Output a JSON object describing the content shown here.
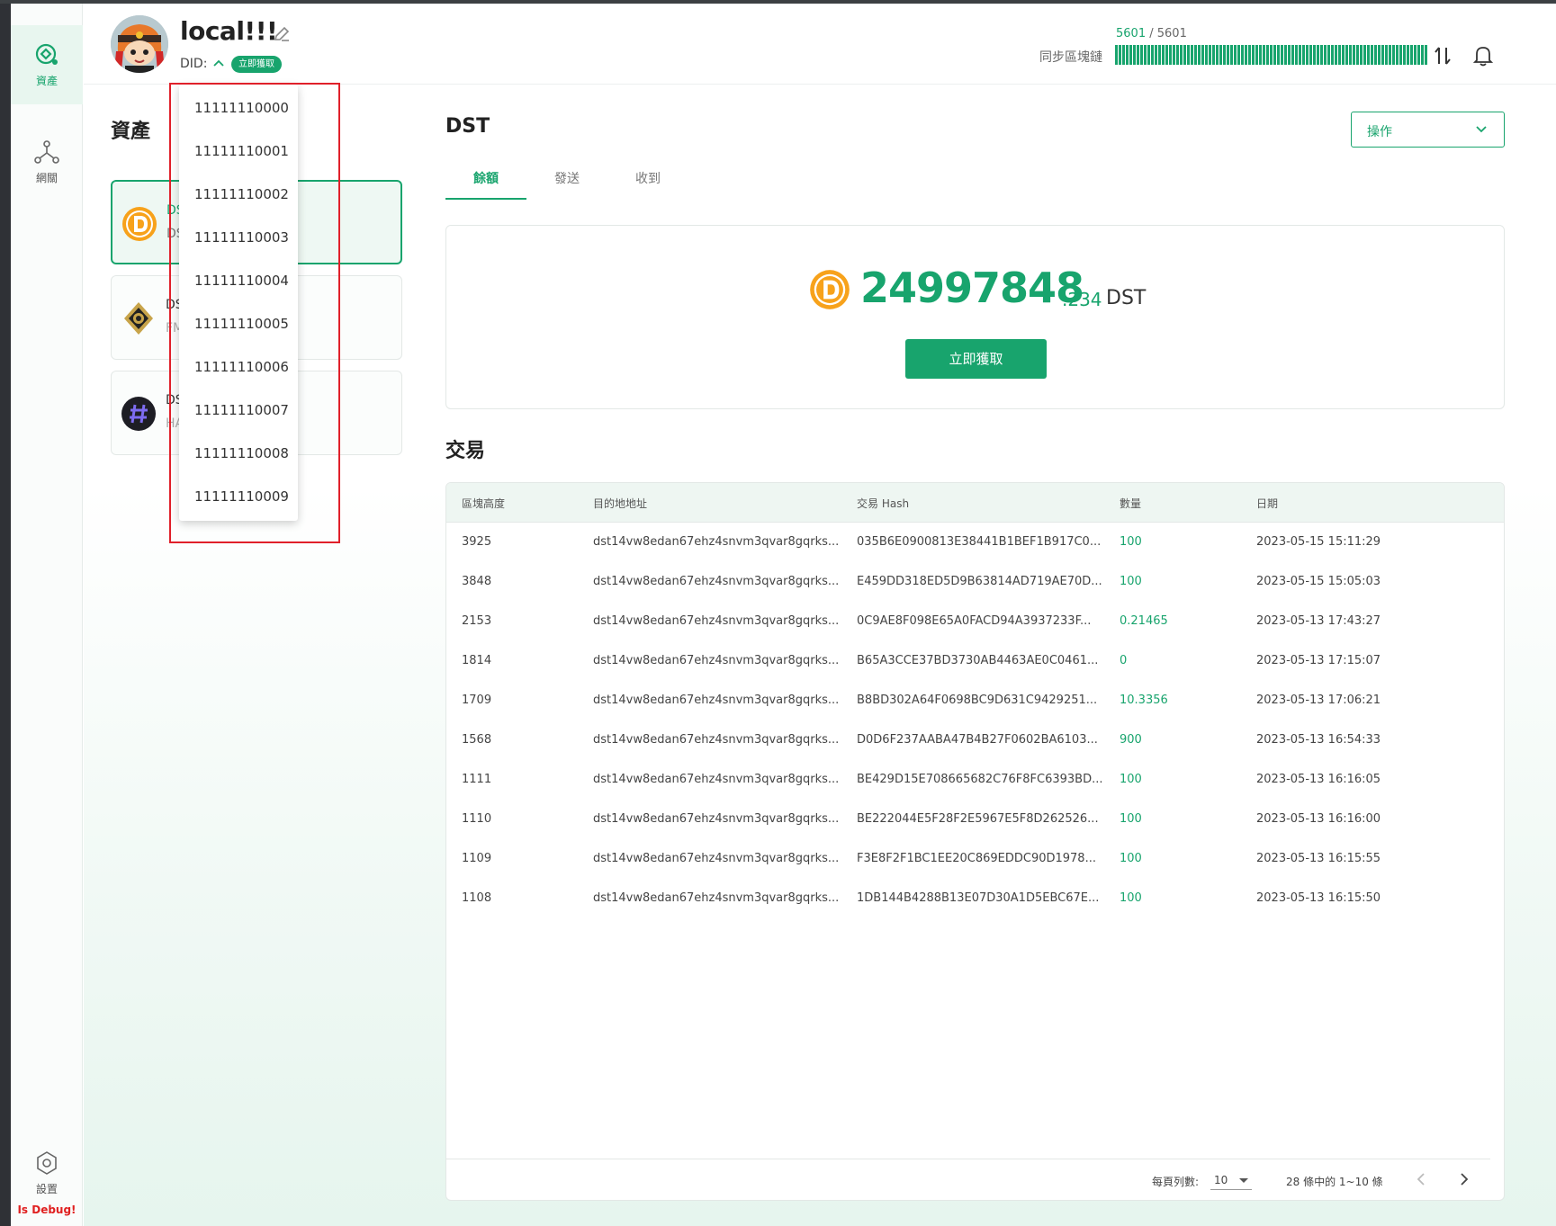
{
  "nav": {
    "assets_label": "資產",
    "network_label": "網關",
    "settings_label": "設置",
    "debug_text": "Is Debug!"
  },
  "header": {
    "wallet_name": "local!!!",
    "did_label": "DID:",
    "did_button": "立即獲取",
    "sync_current": "5601",
    "sync_separator": " / ",
    "sync_total": "5601",
    "sync_label": "同步區塊鏈",
    "sync_progress": 1.0
  },
  "did_dropdown": {
    "items": [
      "11111110000",
      "11111110001",
      "11111110002",
      "11111110003",
      "11111110004",
      "11111110005",
      "11111110006",
      "11111110007",
      "11111110008",
      "11111110009"
    ]
  },
  "assets": {
    "title": "資產",
    "cards": [
      {
        "symbol": "DS",
        "sub": "DS",
        "icon": "dst-coin-icon"
      },
      {
        "symbol": "DS",
        "sub": "FM",
        "icon": "emblem-icon"
      },
      {
        "symbol": "DS",
        "sub": "HA",
        "icon": "hash-icon"
      }
    ]
  },
  "main": {
    "heading": "DST",
    "actions_label": "操作",
    "tabs": [
      "餘額",
      "發送",
      "收到"
    ],
    "balance_int": "24997848",
    "balance_dec": ".234",
    "balance_unit": "DST",
    "claim_button": "立即獲取",
    "transactions_title": "交易"
  },
  "table": {
    "headers": [
      "區塊高度",
      "目的地地址",
      "交易 Hash",
      "數量",
      "日期"
    ],
    "rows": [
      [
        "3925",
        "dst14vw8edan67ehz4snvm3qvar8gqrks...",
        "035B6E0900813E38441B1BEF1B917C0...",
        "100",
        "2023-05-15 15:11:29"
      ],
      [
        "3848",
        "dst14vw8edan67ehz4snvm3qvar8gqrks...",
        "E459DD318ED5D9B63814AD719AE70D...",
        "100",
        "2023-05-15 15:05:03"
      ],
      [
        "2153",
        "dst14vw8edan67ehz4snvm3qvar8gqrks...",
        "0C9AE8F098E65A0FACD94A3937233F...",
        "0.21465",
        "2023-05-13 17:43:27"
      ],
      [
        "1814",
        "dst14vw8edan67ehz4snvm3qvar8gqrks...",
        "B65A3CCE37BD3730AB4463AE0C0461...",
        "0",
        "2023-05-13 17:15:07"
      ],
      [
        "1709",
        "dst14vw8edan67ehz4snvm3qvar8gqrks...",
        "B8BD302A64F0698BC9D631C9429251...",
        "10.3356",
        "2023-05-13 17:06:21"
      ],
      [
        "1568",
        "dst14vw8edan67ehz4snvm3qvar8gqrks...",
        "D0D6F237AABA47B4B27F0602BA6103...",
        "900",
        "2023-05-13 16:54:33"
      ],
      [
        "1111",
        "dst14vw8edan67ehz4snvm3qvar8gqrks...",
        "BE429D15E708665682C76F8FC6393BD...",
        "100",
        "2023-05-13 16:16:05"
      ],
      [
        "1110",
        "dst14vw8edan67ehz4snvm3qvar8gqrks...",
        "BE222044E5F28F2E5967E5F8D262526...",
        "100",
        "2023-05-13 16:16:00"
      ],
      [
        "1109",
        "dst14vw8edan67ehz4snvm3qvar8gqrks...",
        "F3E8F2F1BC1EE20C869EDDC90D1978...",
        "100",
        "2023-05-13 16:15:55"
      ],
      [
        "1108",
        "dst14vw8edan67ehz4snvm3qvar8gqrks...",
        "1DB144B4288B13E07D30A1D5EBC67E...",
        "100",
        "2023-05-13 16:15:50"
      ]
    ],
    "rows_per_page_label": "每頁列數:",
    "rows_per_page": "10",
    "range_text": "28 條中的 1~10 條"
  },
  "colors": {
    "accent": "#18a46d",
    "highlight": "#e0202a"
  }
}
